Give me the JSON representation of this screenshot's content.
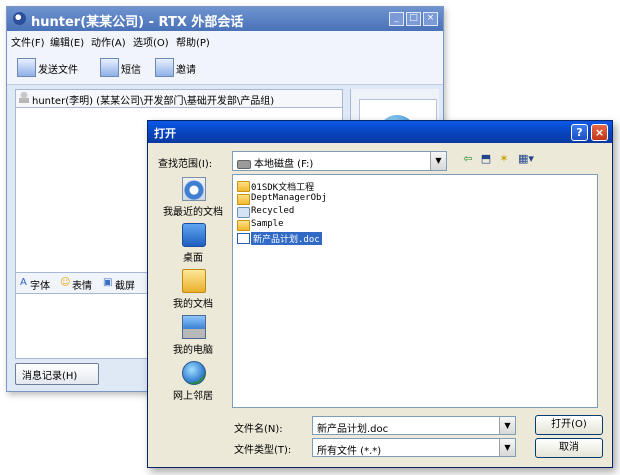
{
  "rtx_window": {
    "title": "hunter(某某公司) - RTX 外部会话",
    "menu": [
      "文件(F)",
      "编辑(E)",
      "动作(A)",
      "选项(O)",
      "帮助(P)"
    ],
    "toolbar": [
      {
        "label": "发送文件",
        "icon": "send-file-icon"
      },
      {
        "label": "短信",
        "icon": "sms-icon"
      },
      {
        "label": "邀请",
        "icon": "invite-icon"
      }
    ],
    "chat_header": "hunter(李明) (某某公司\\开发部门\\基础开发部\\产品组)",
    "format_bar": [
      "字体",
      "表情",
      "截屏"
    ],
    "history_button": "消息记录(H)"
  },
  "open_dialog": {
    "title": "打开",
    "look_in_label": "查找范围(I):",
    "look_in_value": "本地磁盘 (F:)",
    "places": [
      {
        "label": "我最近的文档",
        "icon": "recent-documents-icon"
      },
      {
        "label": "桌面",
        "icon": "desktop-icon"
      },
      {
        "label": "我的文档",
        "icon": "my-documents-icon"
      },
      {
        "label": "我的电脑",
        "icon": "my-computer-icon"
      },
      {
        "label": "网上邻居",
        "icon": "network-places-icon"
      }
    ],
    "files": [
      {
        "name": "01SDK文档工程",
        "type": "folder"
      },
      {
        "name": "DeptManagerObj",
        "type": "folder"
      },
      {
        "name": "Recycled",
        "type": "recycle"
      },
      {
        "name": "Sample",
        "type": "folder"
      },
      {
        "name": "新产品计划.doc",
        "type": "doc",
        "selected": true
      }
    ],
    "filename_label": "文件名(N):",
    "filename_value": "新产品计划.doc",
    "filetype_label": "文件类型(T):",
    "filetype_value": "所有文件 (*.*)",
    "open_button": "打开(O)",
    "cancel_button": "取消"
  },
  "colors": {
    "xp_title_blue": "#0842b9",
    "rtx_title_blue": "#4a72b8",
    "selection_blue": "#316ac5",
    "dialog_face": "#ece9d8"
  }
}
